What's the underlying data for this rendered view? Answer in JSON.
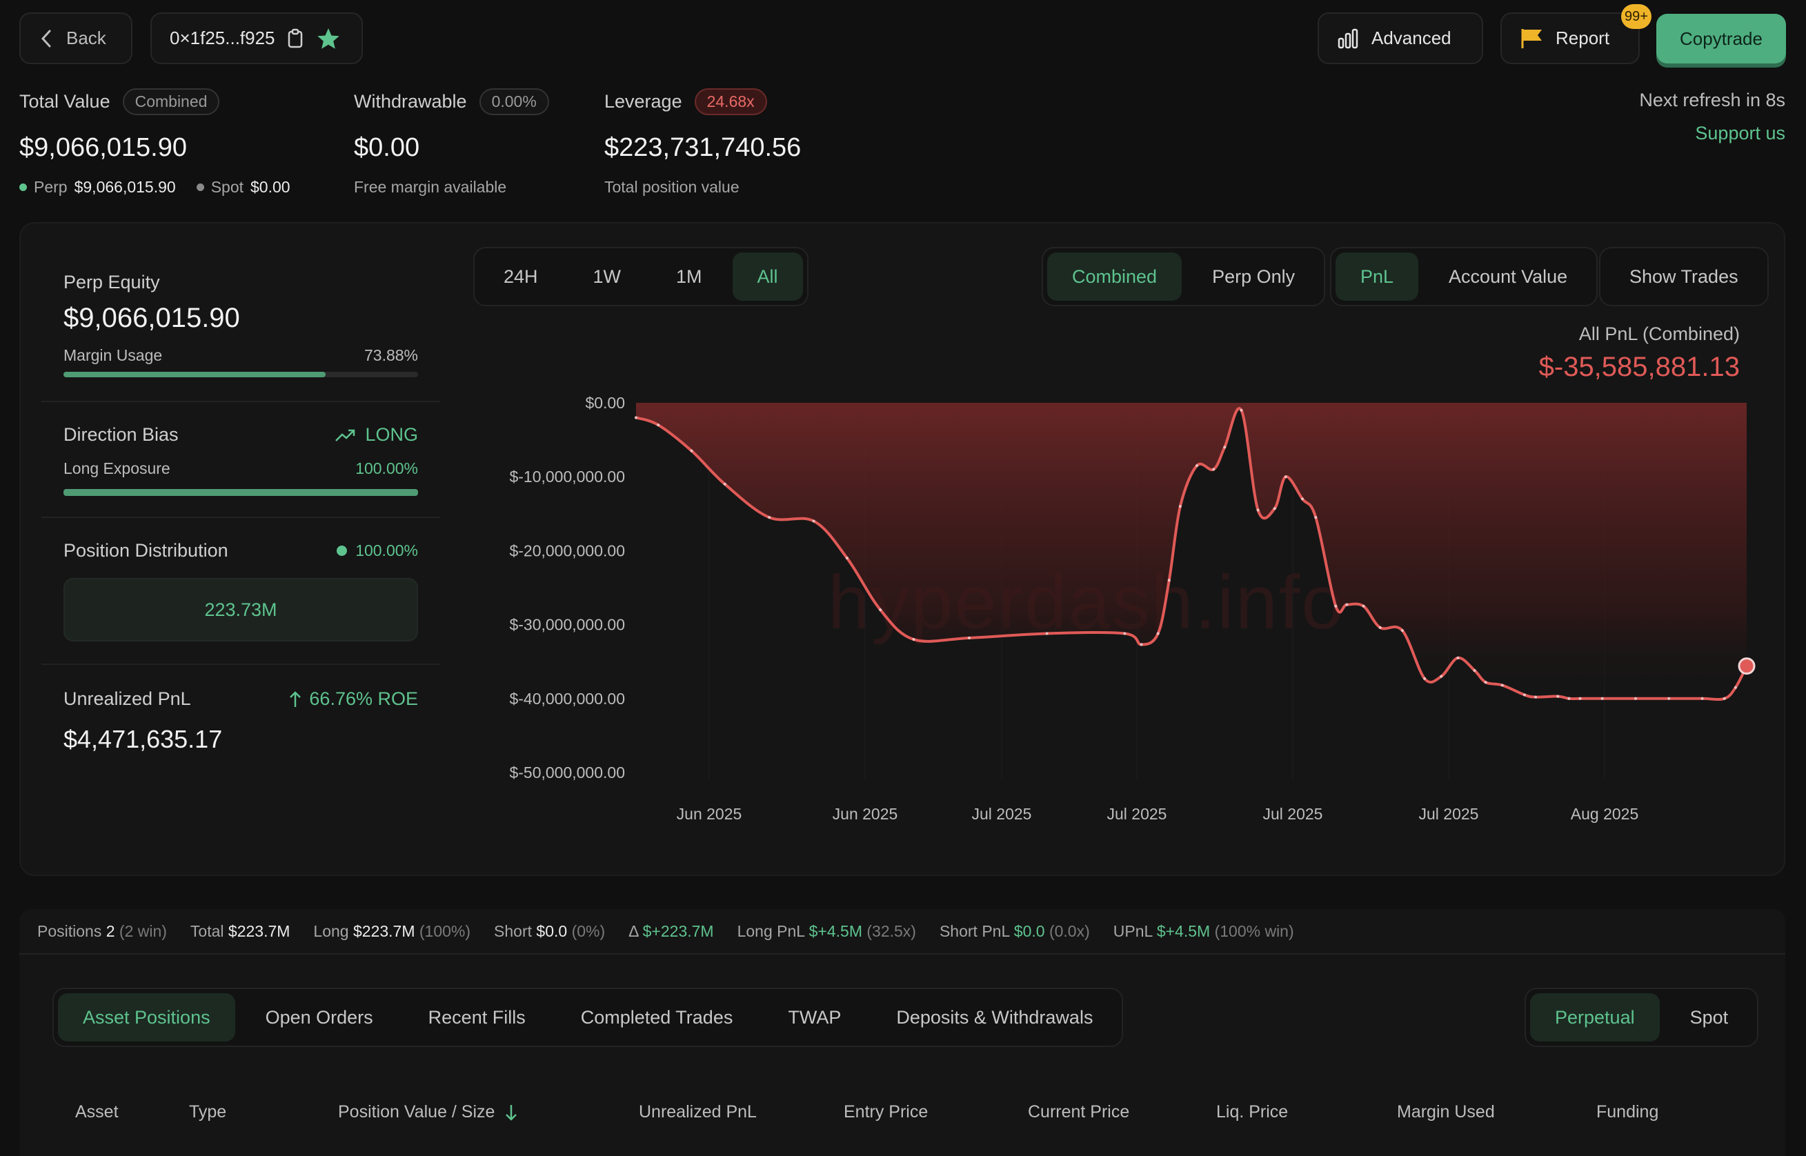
{
  "topbar": {
    "back_label": "Back",
    "address": "0×1f25...f925",
    "advanced_label": "Advanced",
    "report_label": "Report",
    "report_badge": "99+",
    "copytrade_label": "Copytrade"
  },
  "summary": {
    "total_value_label": "Total Value",
    "total_value_pill": "Combined",
    "total_value": "$9,066,015.90",
    "perp_label": "Perp",
    "perp_value": "$9,066,015.90",
    "spot_label": "Spot",
    "spot_value": "$0.00",
    "withdrawable_label": "Withdrawable",
    "withdrawable_pill": "0.00%",
    "withdrawable_value": "$0.00",
    "withdrawable_sub": "Free margin available",
    "leverage_label": "Leverage",
    "leverage_pill": "24.68x",
    "leverage_value": "$223,731,740.56",
    "leverage_sub": "Total position value",
    "refresh_text": "Next refresh in 8s",
    "support_text": "Support us"
  },
  "left_panel": {
    "perp_equity_label": "Perp Equity",
    "perp_equity_value": "$9,066,015.90",
    "margin_usage_label": "Margin Usage",
    "margin_usage_value": "73.88%",
    "margin_usage_fraction": 0.7388,
    "direction_label": "Direction Bias",
    "direction_value": "LONG",
    "long_exposure_label": "Long Exposure",
    "long_exposure_value": "100.00%",
    "long_exposure_fraction": 1.0,
    "position_dist_label": "Position Distribution",
    "position_dist_value": "100.00%",
    "position_dist_box": "223.73M",
    "upnl_label": "Unrealized PnL",
    "upnl_roe": "66.76% ROE",
    "upnl_value": "$4,471,635.17"
  },
  "range_tabs": [
    "24H",
    "1W",
    "1M",
    "All"
  ],
  "range_active": "All",
  "scope_tabs": [
    "Combined",
    "Perp Only"
  ],
  "scope_active": "Combined",
  "metric_tabs": [
    "PnL",
    "Account Value"
  ],
  "metric_active": "PnL",
  "show_trades_label": "Show Trades",
  "pnl_title": "All PnL (Combined)",
  "pnl_value": "$-35,585,881.13",
  "watermark": "hyperdash.info",
  "chart_data": {
    "type": "area",
    "ylim": [
      -50000000,
      0
    ],
    "yticks": [
      "$0.00",
      "$-10,000,000.00",
      "$-20,000,000.00",
      "$-30,000,000.00",
      "$-40,000,000.00",
      "$-50,000,000.00"
    ],
    "xticks": [
      "Jun 2025",
      "Jun 2025",
      "Jul 2025",
      "Jul 2025",
      "Jul 2025",
      "Jul 2025",
      "Aug 2025"
    ],
    "x": [
      0,
      0.02,
      0.05,
      0.08,
      0.12,
      0.16,
      0.19,
      0.22,
      0.25,
      0.3,
      0.37,
      0.44,
      0.455,
      0.47,
      0.48,
      0.49,
      0.505,
      0.52,
      0.53,
      0.545,
      0.56,
      0.575,
      0.585,
      0.6,
      0.612,
      0.63,
      0.64,
      0.655,
      0.67,
      0.69,
      0.71,
      0.725,
      0.74,
      0.755,
      0.765,
      0.78,
      0.8,
      0.81,
      0.83,
      0.84,
      0.85,
      0.87,
      0.9,
      0.93,
      0.96,
      0.98,
      0.99,
      1.0
    ],
    "y": [
      -2000000,
      -3000000,
      -6500000,
      -11000000,
      -15500000,
      -16000000,
      -21000000,
      -28000000,
      -32000000,
      -31800000,
      -31200000,
      -31200000,
      -32700000,
      -31200000,
      -24000000,
      -14000000,
      -8500000,
      -9000000,
      -6000000,
      -1000000,
      -14500000,
      -14300000,
      -10000000,
      -13000000,
      -15500000,
      -27500000,
      -27300000,
      -27500000,
      -30400000,
      -30800000,
      -37300000,
      -37000000,
      -34500000,
      -36200000,
      -37800000,
      -38200000,
      -39500000,
      -39800000,
      -39700000,
      -40000000,
      -40000000,
      -40000000,
      -40000000,
      -40000000,
      -40000000,
      -40000000,
      -38500000,
      -35600000
    ],
    "line_color": "#e05a57",
    "fill_color": "#6b2626"
  },
  "stats": {
    "positions_label": "Positions",
    "positions_value": "2",
    "positions_note": "(2 win)",
    "total_label": "Total",
    "total_value": "$223.7M",
    "long_label": "Long",
    "long_value": "$223.7M",
    "long_note": "(100%)",
    "short_label": "Short",
    "short_value": "$0.0",
    "short_note": "(0%)",
    "delta_label": "Δ",
    "delta_value": "$+223.7M",
    "longpnl_label": "Long PnL",
    "longpnl_value": "$+4.5M",
    "longpnl_note": "(32.5x)",
    "shortpnl_label": "Short PnL",
    "shortpnl_value": "$0.0",
    "shortpnl_note": "(0.0x)",
    "upnl_label": "UPnL",
    "upnl_value": "$+4.5M",
    "upnl_note": "(100% win)"
  },
  "bottom_tabs": [
    "Asset Positions",
    "Open Orders",
    "Recent Fills",
    "Completed Trades",
    "TWAP",
    "Deposits & Withdrawals"
  ],
  "bottom_active": "Asset Positions",
  "market_tabs": [
    "Perpetual",
    "Spot"
  ],
  "market_active": "Perpetual",
  "table_headers": [
    "Asset",
    "Type",
    "Position Value / Size",
    "Unrealized PnL",
    "Entry Price",
    "Current Price",
    "Liq. Price",
    "Margin Used",
    "Funding"
  ]
}
